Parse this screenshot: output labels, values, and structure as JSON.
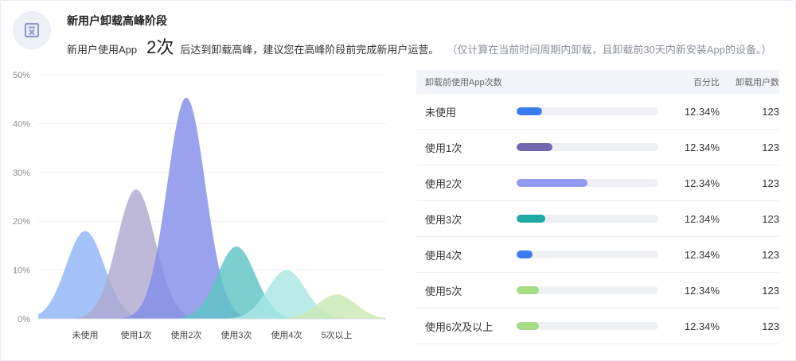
{
  "header": {
    "title": "新用户卸载高峰阶段",
    "desc_prefix": "新用户使用App",
    "highlight": "2次",
    "desc_suffix": "后达到卸载高峰，建议您在高峰阶段前完成新用户运营。",
    "note": "（仅计算在当前时间周期内卸载，且卸载前30天内新安装App的设备。）"
  },
  "chart_data": {
    "type": "area",
    "title": "",
    "xlabel": "",
    "ylabel": "",
    "ylim": [
      0,
      50
    ],
    "yticks": [
      "0%",
      "10%",
      "20%",
      "30%",
      "40%",
      "50%"
    ],
    "categories": [
      "未使用",
      "使用1次",
      "使用2次",
      "使用3次",
      "使用4次",
      "5次以上"
    ],
    "grid": true,
    "legend": "none",
    "series": [
      {
        "peak_index": 0,
        "peak": 18,
        "color": "#8fb6f7"
      },
      {
        "peak_index": 1,
        "peak": 26.5,
        "color": "#b0a9d0"
      },
      {
        "peak_index": 2,
        "peak": 45.3,
        "color": "#838ee9"
      },
      {
        "peak_index": 3,
        "peak": 14.8,
        "color": "#5ec4c4"
      },
      {
        "peak_index": 4,
        "peak": 10,
        "color": "#a9e6e4"
      },
      {
        "peak_index": 5,
        "peak": 5,
        "color": "#cbe8b3"
      }
    ]
  },
  "table": {
    "headers": {
      "label": "卸载前使用App次数",
      "pct": "百分比",
      "users": "卸载用户数"
    },
    "rows": [
      {
        "label": "未使用",
        "pct": "12.34%",
        "users": "123",
        "fill": 0.18,
        "color": "#3a7cf0"
      },
      {
        "label": "使用1次",
        "pct": "12.34%",
        "users": "123",
        "fill": 0.25,
        "color": "#7366b0"
      },
      {
        "label": "使用2次",
        "pct": "12.34%",
        "users": "123",
        "fill": 0.5,
        "color": "#8f9af0"
      },
      {
        "label": "使用3次",
        "pct": "12.34%",
        "users": "123",
        "fill": 0.2,
        "color": "#1fa9a4"
      },
      {
        "label": "使用4次",
        "pct": "12.34%",
        "users": "123",
        "fill": 0.11,
        "color": "#3a7cf0"
      },
      {
        "label": "使用5次",
        "pct": "12.34%",
        "users": "123",
        "fill": 0.16,
        "color": "#a6dc83"
      },
      {
        "label": "使用6次及以上",
        "pct": "12.34%",
        "users": "123",
        "fill": 0.16,
        "color": "#a6dc83"
      }
    ]
  }
}
